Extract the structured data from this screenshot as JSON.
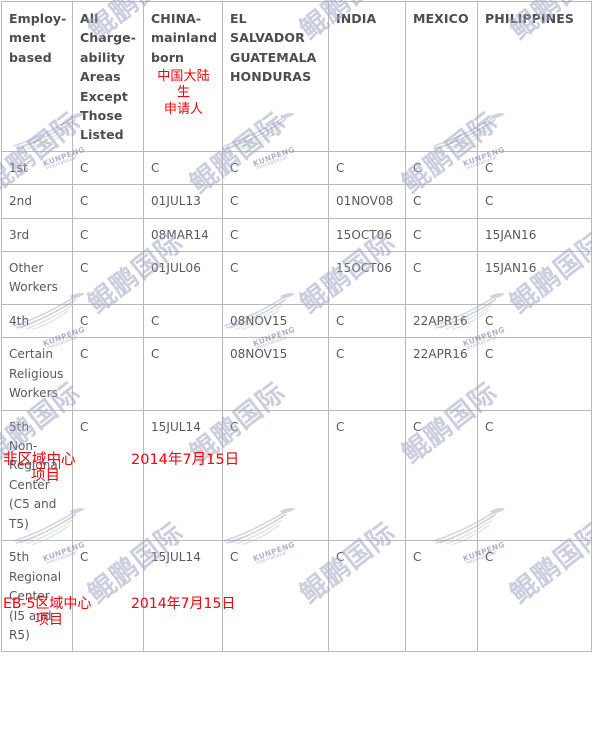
{
  "table": {
    "headers": [
      "Employ-\nment\nbased",
      "All\nCharge-\nability\nAreas\nExcept\nThose\nListed",
      "CHINA-\nmainland\nborn",
      "EL\nSALVADOR\nGUATEMALA\nHONDURAS",
      "INDIA",
      "MEXICO",
      "PHILIPPINES"
    ],
    "header_china_zh": "中国大陆生\n申请人",
    "rows": [
      {
        "category": "1st",
        "cells": [
          "C",
          "C",
          "C",
          "C",
          "C",
          "C"
        ]
      },
      {
        "category": "2nd",
        "cells": [
          "C",
          "01JUL13",
          "C",
          "01NOV08",
          "C",
          "C"
        ]
      },
      {
        "category": "3rd",
        "cells": [
          "C",
          "08MAR14",
          "C",
          "15OCT06",
          "C",
          "15JAN16"
        ]
      },
      {
        "category": "Other\nWorkers",
        "cells": [
          "C",
          "01JUL06",
          "C",
          "15OCT06",
          "C",
          "15JAN16"
        ]
      },
      {
        "category": "4th",
        "cells": [
          "C",
          "C",
          "08NOV15",
          "C",
          "22APR16",
          "C"
        ]
      },
      {
        "category": "Certain\nReligious\nWorkers",
        "cells": [
          "C",
          "C",
          "08NOV15",
          "C",
          "22APR16",
          "C"
        ]
      },
      {
        "category": "5th\nNon-\nRegional\nCenter\n(C5 and\nT5)",
        "cells": [
          "C",
          "15JUL14",
          "C",
          "C",
          "C",
          "C"
        ]
      },
      {
        "category": "5th\nRegional\nCenter\n(I5 and\nR5)",
        "cells": [
          "C",
          "15JUL14",
          "C",
          "C",
          "C",
          "C"
        ]
      }
    ]
  },
  "annotations": {
    "non_regional_label": "非区域中心",
    "non_regional_label2": "项目",
    "non_regional_date": "2014年7月15日",
    "regional_label": "EB-5区域中心",
    "regional_label2": "项目",
    "regional_date": "2014年7月15日"
  },
  "watermark": {
    "cjk": "鲲鹏国际",
    "brand": "KUNPENG",
    "brand_sub": "International"
  },
  "colors": {
    "red_annotation": "#fb0007",
    "header_text": "#4c4c52",
    "cell_text": "#58585e",
    "border": "#b9b9b9",
    "watermark": "#a3a7c6"
  }
}
